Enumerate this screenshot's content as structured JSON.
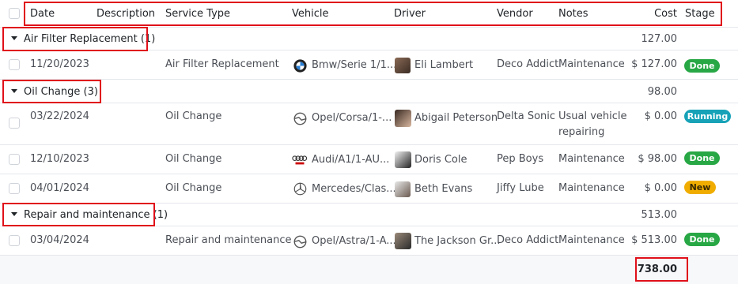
{
  "header": {
    "date": "Date",
    "description": "Description",
    "service_type": "Service Type",
    "vehicle": "Vehicle",
    "driver": "Driver",
    "vendor": "Vendor",
    "notes": "Notes",
    "cost": "Cost",
    "stage": "Stage"
  },
  "groups": [
    {
      "label": "Air Filter Replacement (1)",
      "total": "127.00",
      "rows": [
        {
          "date": "11/20/2023",
          "service_type": "Air Filter Replacement",
          "vehicle": "Bmw/Serie 1/1...",
          "driver": "Eli Lambert",
          "vendor": "Deco Addict",
          "notes": "Maintenance",
          "notes2": "",
          "cost": "$ 127.00",
          "stage": "Done"
        }
      ]
    },
    {
      "label": "Oil Change (3)",
      "total": "98.00",
      "rows": [
        {
          "date": "03/22/2024",
          "service_type": "Oil Change",
          "vehicle": "Opel/Corsa/1-...",
          "driver": "Abigail Peterson",
          "vendor": "Delta Sonic",
          "notes": "Usual vehicle",
          "notes2": "repairing",
          "cost": "$ 0.00",
          "stage": "Running"
        },
        {
          "date": "12/10/2023",
          "service_type": "Oil Change",
          "vehicle": "Audi/A1/1-AU...",
          "driver": "Doris Cole",
          "vendor": "Pep Boys",
          "notes": "Maintenance",
          "notes2": "",
          "cost": "$ 98.00",
          "stage": "Done"
        },
        {
          "date": "04/01/2024",
          "service_type": "Oil Change",
          "vehicle": "Mercedes/Clas...",
          "driver": "Beth Evans",
          "vendor": "Jiffy Lube",
          "notes": "Maintenance",
          "notes2": "",
          "cost": "$ 0.00",
          "stage": "New"
        }
      ]
    },
    {
      "label": "Repair and maintenance (1)",
      "total": "513.00",
      "rows": [
        {
          "date": "03/04/2024",
          "service_type": "Repair and maintenance",
          "vehicle": "Opel/Astra/1-A...",
          "driver": "The Jackson Gr...",
          "vendor": "Deco Addict",
          "notes": "Maintenance",
          "notes2": "",
          "cost": "$ 513.00",
          "stage": "Done"
        }
      ]
    }
  ],
  "footer": {
    "grand_total": "738.00"
  },
  "colors": {
    "done": "#28a745",
    "running": "#17a2b8",
    "new": "#f0ad00",
    "highlight": "#e0101a"
  },
  "icons": {
    "bmw": "bmw-logo-icon",
    "opel": "opel-logo-icon",
    "audi": "audi-logo-icon",
    "mercedes": "mercedes-logo-icon",
    "caret": "caret-down-icon"
  }
}
